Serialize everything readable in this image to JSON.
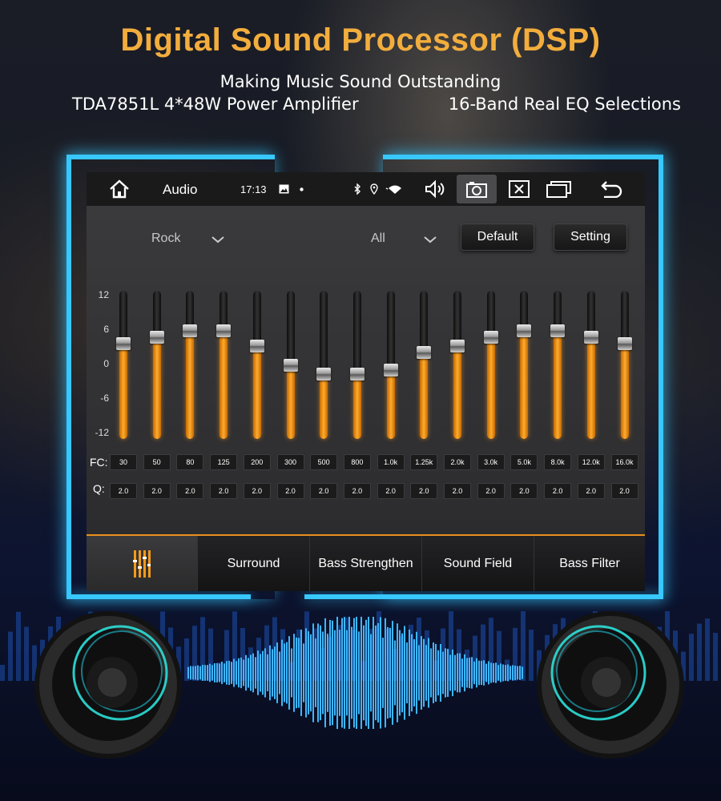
{
  "headline": "Digital Sound Processor (DSP)",
  "subline": "Making Music Sound Outstanding",
  "specs": [
    "TDA7851L 4*48W Power Amplifier",
    "16-Band Real EQ Selections"
  ],
  "statusbar": {
    "app_title": "Audio",
    "time": "17:13",
    "icons": [
      "home-icon",
      "image-icon",
      "bluetooth-icon",
      "location-icon",
      "wifi-icon",
      "volume-icon",
      "screenshot-icon",
      "close-window-icon",
      "recent-apps-icon",
      "back-icon"
    ]
  },
  "eq": {
    "preset": "Rock",
    "channel": "All",
    "default_label": "Default",
    "setting_label": "Setting",
    "y_ticks": [
      "12",
      "6",
      "0",
      "-6",
      "-12"
    ],
    "fc_label": "FC:",
    "q_label": "Q:",
    "bands": [
      {
        "fc": "30",
        "q": "2.0",
        "gain": 3.5
      },
      {
        "fc": "50",
        "q": "2.0",
        "gain": 4.5
      },
      {
        "fc": "80",
        "q": "2.0",
        "gain": 5.5
      },
      {
        "fc": "125",
        "q": "2.0",
        "gain": 5.5
      },
      {
        "fc": "200",
        "q": "2.0",
        "gain": 3.0
      },
      {
        "fc": "300",
        "q": "2.0",
        "gain": 0
      },
      {
        "fc": "500",
        "q": "2.0",
        "gain": -1.5
      },
      {
        "fc": "800",
        "q": "2.0",
        "gain": -1.5
      },
      {
        "fc": "1.0k",
        "q": "2.0",
        "gain": -0.8
      },
      {
        "fc": "1.25k",
        "q": "2.0",
        "gain": 2.0
      },
      {
        "fc": "2.0k",
        "q": "2.0",
        "gain": 3.0
      },
      {
        "fc": "3.0k",
        "q": "2.0",
        "gain": 4.5
      },
      {
        "fc": "5.0k",
        "q": "2.0",
        "gain": 5.5
      },
      {
        "fc": "8.0k",
        "q": "2.0",
        "gain": 5.5
      },
      {
        "fc": "12.0k",
        "q": "2.0",
        "gain": 4.5
      },
      {
        "fc": "16.0k",
        "q": "2.0",
        "gain": 3.5
      }
    ],
    "range": [
      -12,
      12
    ]
  },
  "tabs": [
    {
      "label": "",
      "icon": "equalizer-icon",
      "active": true
    },
    {
      "label": "Surround",
      "active": false
    },
    {
      "label": "Bass Strengthen",
      "active": false
    },
    {
      "label": "Sound Field",
      "active": false
    },
    {
      "label": "Bass Filter",
      "active": false
    }
  ],
  "colors": {
    "accent": "#f2ad3d",
    "neon": "#37c8ff",
    "eq_fill": "#ffab2e"
  }
}
